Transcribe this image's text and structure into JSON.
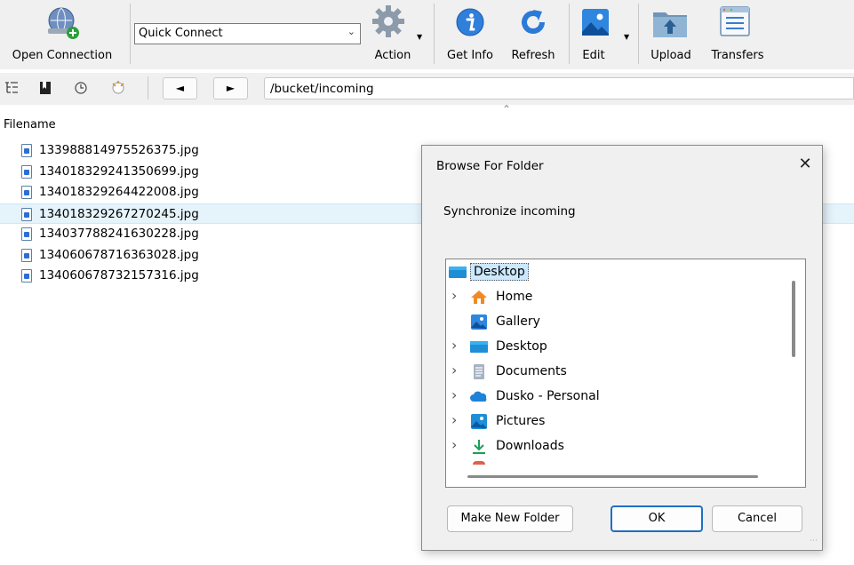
{
  "toolbar": {
    "open_connection": "Open Connection",
    "quick_connect": "Quick Connect",
    "action": "Action",
    "get_info": "Get Info",
    "refresh": "Refresh",
    "edit": "Edit",
    "upload": "Upload",
    "transfers": "Transfers"
  },
  "nav": {
    "back": "◄",
    "forward": "►",
    "path": "/bucket/incoming"
  },
  "list": {
    "header": "Filename",
    "files": [
      "133988814975526375.jpg",
      "134018329241350699.jpg",
      "134018329264422008.jpg",
      "134018329267270245.jpg",
      "134037788241630228.jpg",
      "134060678716363028.jpg",
      "134060678732157316.jpg"
    ],
    "selected_index": 3
  },
  "dialog": {
    "title": "Browse For Folder",
    "close": "✕",
    "description": "Synchronize incoming",
    "tree": [
      {
        "label": "Desktop",
        "icon": "desktop-icon",
        "root": true
      },
      {
        "label": "Home",
        "icon": "home-icon",
        "expandable": true
      },
      {
        "label": "Gallery",
        "icon": "gallery-icon",
        "expandable": false
      },
      {
        "label": "Desktop",
        "icon": "desktop-icon",
        "expandable": true
      },
      {
        "label": "Documents",
        "icon": "documents-icon",
        "expandable": true
      },
      {
        "label": "Dusko - Personal",
        "icon": "onedrive-icon",
        "expandable": true
      },
      {
        "label": "Pictures",
        "icon": "pictures-icon",
        "expandable": true
      },
      {
        "label": "Downloads",
        "icon": "downloads-icon",
        "expandable": true
      }
    ],
    "make_new_folder": "Make New Folder",
    "ok": "OK",
    "cancel": "Cancel"
  },
  "colors": {
    "selection": "#e5f3fb",
    "accent": "#1f6fc4",
    "toolbar_bg": "#f0f0f0"
  }
}
